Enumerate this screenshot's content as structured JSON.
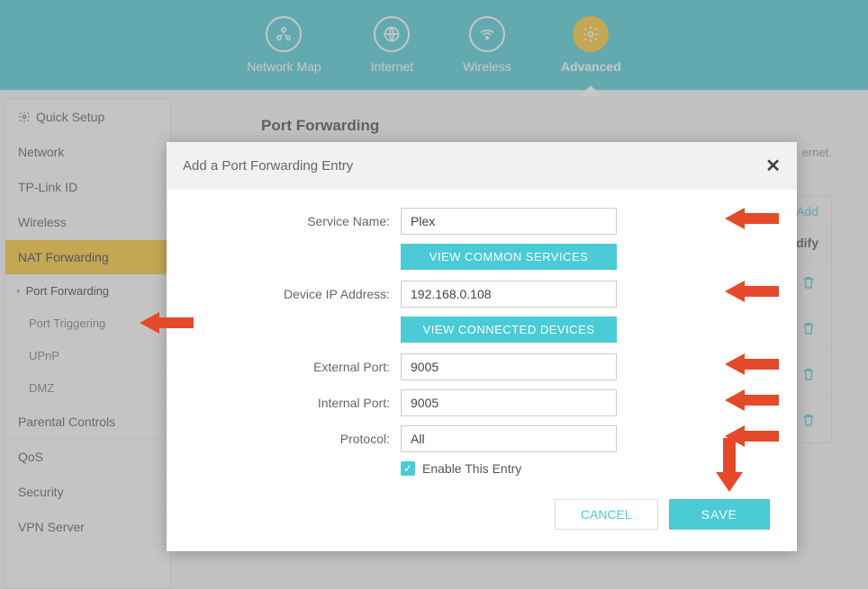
{
  "topnav": {
    "items": [
      {
        "label": "Network Map",
        "icon": "network-map-icon"
      },
      {
        "label": "Internet",
        "icon": "globe-icon"
      },
      {
        "label": "Wireless",
        "icon": "wifi-icon"
      },
      {
        "label": "Advanced",
        "icon": "gear-icon",
        "active": true
      }
    ]
  },
  "sidebar": {
    "items": [
      {
        "label": "Quick Setup",
        "icon": "gear-icon"
      },
      {
        "label": "Network"
      },
      {
        "label": "TP-Link ID"
      },
      {
        "label": "Wireless"
      },
      {
        "label": "NAT Forwarding",
        "active_category": true,
        "subitems": [
          {
            "label": "Port Forwarding",
            "active": true
          },
          {
            "label": "Port Triggering"
          },
          {
            "label": "UPnP"
          },
          {
            "label": "DMZ"
          }
        ]
      },
      {
        "label": "Parental Controls"
      },
      {
        "label": "QoS"
      },
      {
        "label": "Security"
      },
      {
        "label": "VPN Server"
      }
    ]
  },
  "main": {
    "title": "Port Forwarding",
    "description_tail": "ernet.",
    "add_label": "Add",
    "column_modify": "Modify",
    "row_count": 4
  },
  "modal": {
    "title": "Add a Port Forwarding Entry",
    "fields": {
      "service_name": {
        "label": "Service Name:",
        "value": "Plex"
      },
      "view_common_services": "VIEW COMMON SERVICES",
      "device_ip": {
        "label": "Device IP Address:",
        "value": "192.168.0.108"
      },
      "view_connected_devices": "VIEW CONNECTED DEVICES",
      "external_port": {
        "label": "External Port:",
        "value": "9005"
      },
      "internal_port": {
        "label": "Internal Port:",
        "value": "9005"
      },
      "protocol": {
        "label": "Protocol:",
        "value": "All"
      },
      "enable_entry": {
        "label": "Enable This Entry",
        "checked": true
      }
    },
    "buttons": {
      "cancel": "CANCEL",
      "save": "SAVE"
    }
  },
  "colors": {
    "teal": "#4acbd6",
    "yellow": "#f7c52d",
    "arrow_red": "#e44a2a"
  }
}
